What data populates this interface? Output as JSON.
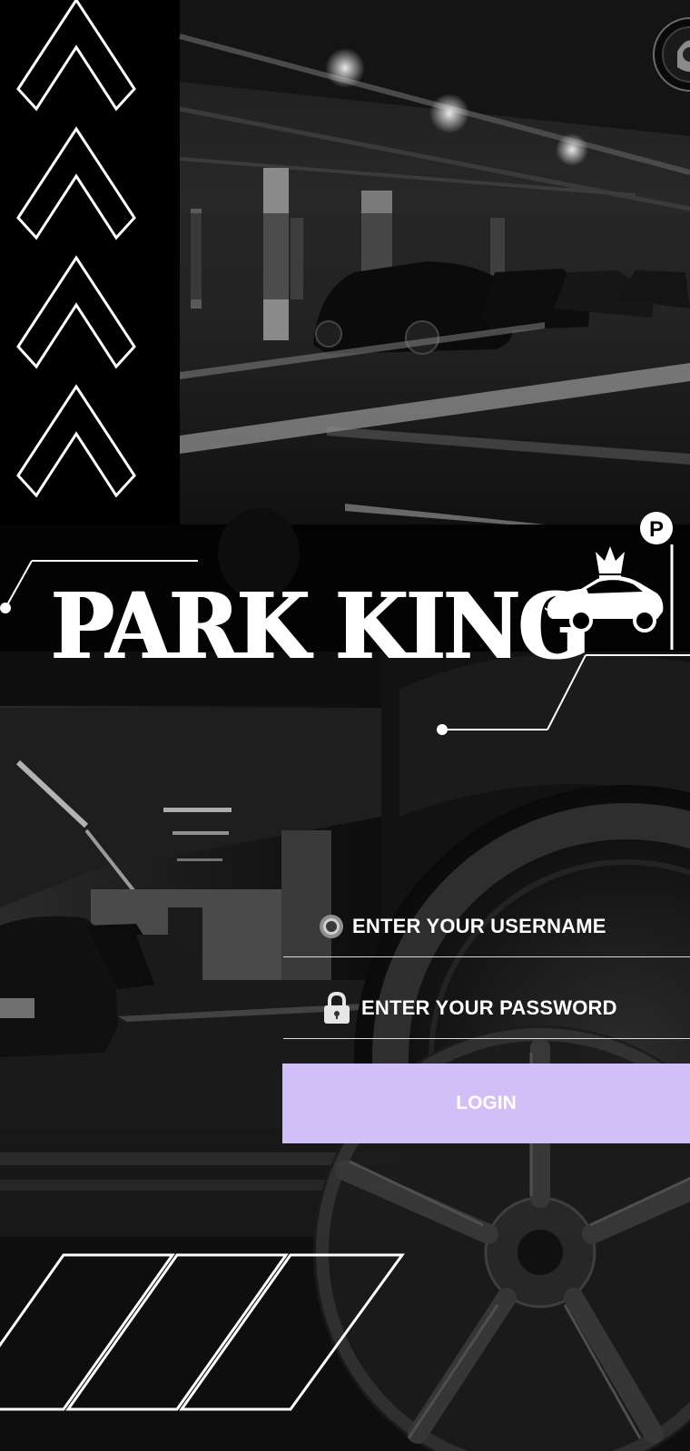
{
  "app": {
    "brand": "PARK KING"
  },
  "login_form": {
    "username_label": "ENTER YOUR USERNAME",
    "password_label": "ENTER YOUR PASSWORD",
    "login_label": "LOGIN"
  },
  "icons": {
    "username": "radio-dot-icon",
    "password": "lock-icon",
    "logo": "crowned-car-parking-logo",
    "corner": "profile-badge-icon",
    "parking_sign": "P"
  },
  "colors": {
    "background": "#050505",
    "text": "#ffffff",
    "login_button": "#d1c0f7"
  }
}
